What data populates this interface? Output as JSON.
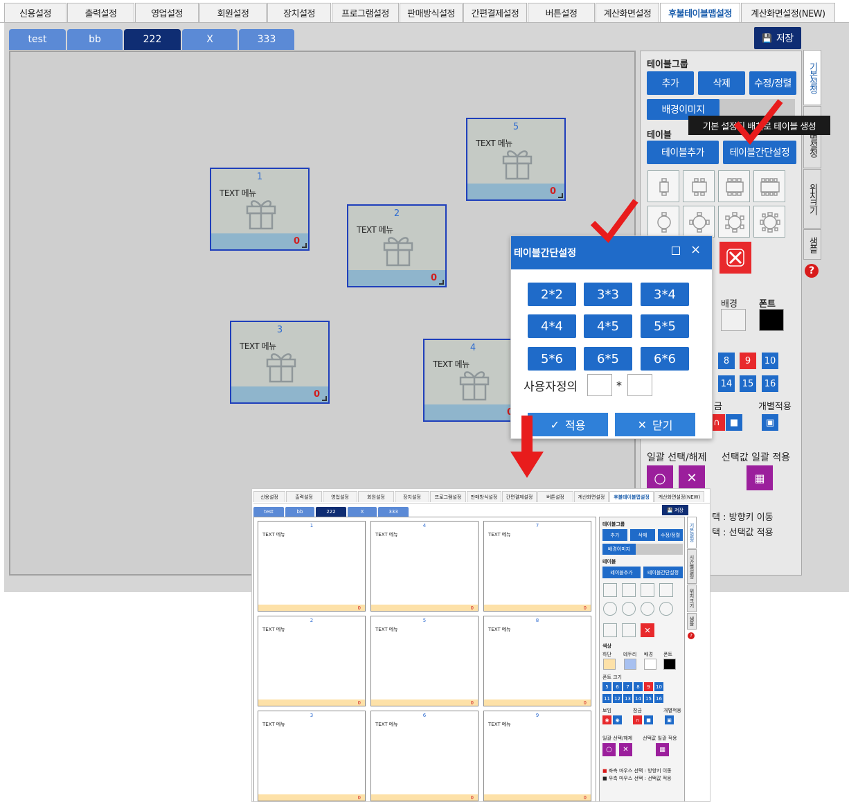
{
  "top_tabs": [
    "신용설정",
    "출력설정",
    "영업설정",
    "회원설정",
    "장치설정",
    "프로그램설정",
    "판매방식설정",
    "간편결제설정",
    "버튼설정",
    "계산화면설정",
    "후불테이블맵설정",
    "계산화면설정(NEW)"
  ],
  "save_label": "저장",
  "groups": [
    "test",
    "bb",
    "222",
    "X",
    "333"
  ],
  "tables": [
    {
      "num": "1",
      "text": "TEXT 메뉴",
      "count": "0"
    },
    {
      "num": "2",
      "text": "TEXT 메뉴",
      "count": "0"
    },
    {
      "num": "3",
      "text": "TEXT 메뉴",
      "count": "0"
    },
    {
      "num": "4",
      "text": "TEXT 메뉴",
      "count": "0"
    },
    {
      "num": "5",
      "text": "TEXT 메뉴",
      "count": "0"
    }
  ],
  "side_tabs": [
    "기본설정",
    "시간별설정",
    "위치크기",
    "샘플"
  ],
  "panel": {
    "group_title": "테이블그룹",
    "add": "추가",
    "delete": "삭제",
    "edit_sort": "수정/정렬",
    "bg_image": "배경이미지",
    "table_title": "테이블",
    "table_add": "테이블추가",
    "table_simple": "테이블간단설정",
    "bg": "배경",
    "font": "폰트",
    "individual": "개별적용",
    "lock_partial": "금",
    "select_all": "일괄 선택/해제",
    "apply_selected": "선택값 일괄 적용",
    "hint1_partial": "택 : 방향키 이동",
    "hint2_partial": "택 : 선택값 적용",
    "font_sizes_row1": [
      "8",
      "9",
      "10"
    ],
    "font_sizes_row2": [
      "14",
      "15",
      "16"
    ]
  },
  "tooltip": "기본 설정된 배치로 테이블 생성",
  "dialog": {
    "title": "테이블간단설정",
    "grid_options": [
      "2*2",
      "3*3",
      "3*4",
      "4*4",
      "4*5",
      "5*5",
      "5*6",
      "6*5",
      "6*6"
    ],
    "custom_label": "사용자정의",
    "times": "*",
    "apply": "적용",
    "close": "닫기"
  },
  "result_preview": {
    "top_tabs": [
      "신용설정",
      "출력설정",
      "영업설정",
      "회원설정",
      "장치설정",
      "프로그램설정",
      "판매방식설정",
      "간편결제설정",
      "버튼설정",
      "계산화면설정",
      "후불테이블맵설정",
      "계산화면설정(NEW)"
    ],
    "save_label": "저장",
    "groups": [
      "test",
      "bb",
      "222",
      "X",
      "333"
    ],
    "tables": [
      {
        "num": "1",
        "text": "TEXT 메뉴",
        "count": "0"
      },
      {
        "num": "4",
        "text": "TEXT 메뉴",
        "count": "0"
      },
      {
        "num": "7",
        "text": "TEXT 메뉴",
        "count": "0"
      },
      {
        "num": "2",
        "text": "TEXT 메뉴",
        "count": "0"
      },
      {
        "num": "5",
        "text": "TEXT 메뉴",
        "count": "0"
      },
      {
        "num": "8",
        "text": "TEXT 메뉴",
        "count": "0"
      },
      {
        "num": "3",
        "text": "TEXT 메뉴",
        "count": "0"
      },
      {
        "num": "6",
        "text": "TEXT 메뉴",
        "count": "0"
      },
      {
        "num": "9",
        "text": "TEXT 메뉴",
        "count": "0"
      }
    ],
    "side_tabs": [
      "기본설정",
      "시간별설정",
      "위치크기",
      "샘플"
    ],
    "group_title": "테이블그룹",
    "add": "추가",
    "delete": "삭제",
    "edit_sort": "수정/정렬",
    "bg_image": "배경이미지",
    "table_title": "테이블",
    "table_add": "테이블추가",
    "table_simple": "테이블간단설정",
    "color_title": "색상",
    "color_labels": [
      "하단",
      "테두리",
      "배경",
      "폰트"
    ],
    "font_size_title": "폰트 크기",
    "font_sizes": [
      "5",
      "6",
      "7",
      "8",
      "9",
      "10",
      "11",
      "12",
      "13",
      "14",
      "15",
      "16"
    ],
    "show": "보임",
    "lock": "잠금",
    "individual": "개별적용",
    "select_all": "일괄 선택/해제",
    "apply_selected": "선택값 일괄 적용",
    "hint1": "좌측 마우스 선택 : 방향키 이동",
    "hint2": "우측 마우스 선택 : 선택값 적용"
  },
  "colors": {
    "accent": "#1f6bc9",
    "dark_tab": "#0f2d73",
    "red": "#e8292c",
    "purple": "#9b1f9c",
    "check": "#e81c1c"
  }
}
